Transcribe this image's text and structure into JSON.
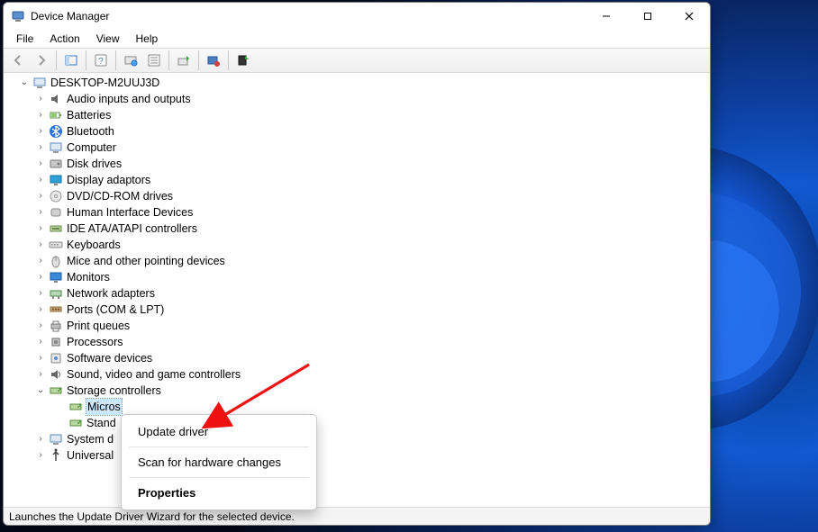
{
  "window": {
    "title": "Device Manager"
  },
  "menubar": {
    "file": "File",
    "action": "Action",
    "view": "View",
    "help": "Help"
  },
  "tree": {
    "root": "DESKTOP-M2UUJ3D",
    "items": [
      "Audio inputs and outputs",
      "Batteries",
      "Bluetooth",
      "Computer",
      "Disk drives",
      "Display adaptors",
      "DVD/CD-ROM drives",
      "Human Interface Devices",
      "IDE ATA/ATAPI controllers",
      "Keyboards",
      "Mice and other pointing devices",
      "Monitors",
      "Network adapters",
      "Ports (COM & LPT)",
      "Print queues",
      "Processors",
      "Software devices",
      "Sound, video and game controllers",
      "Storage controllers",
      "System devices",
      "Universal Serial Bus controllers"
    ],
    "storage_children": {
      "item0_prefix": "Micros",
      "item1_prefix": "Stand"
    },
    "truncated_suffix": "System d",
    "usb_truncated": "Universal"
  },
  "context_menu": {
    "update": "Update driver",
    "scan": "Scan for hardware changes",
    "properties": "Properties"
  },
  "statusbar": {
    "text": "Launches the Update Driver Wizard for the selected device."
  }
}
